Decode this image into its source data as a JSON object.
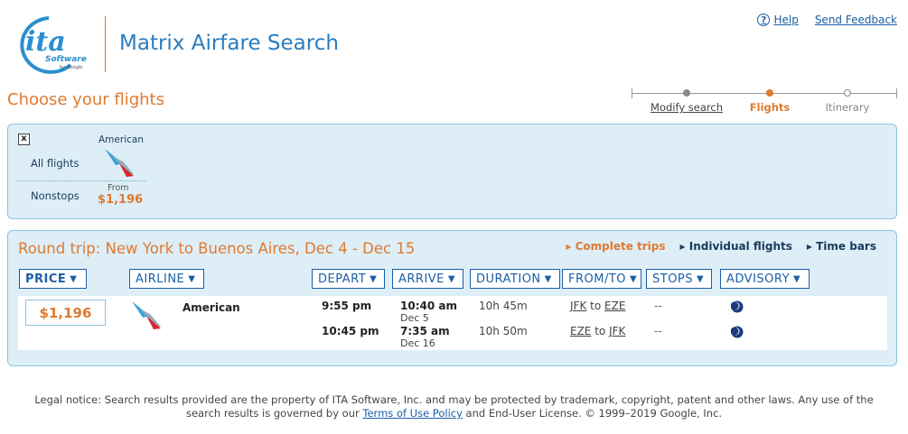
{
  "header": {
    "logo_text": "ita",
    "logo_sub": "Software",
    "logo_byline": "by Google",
    "app_title": "Matrix Airfare Search",
    "help_label": "Help",
    "feedback_label": "Send Feedback"
  },
  "page_heading": "Choose your flights",
  "steps": [
    {
      "label": "Modify search"
    },
    {
      "label": "Flights"
    },
    {
      "label": "Itinerary"
    }
  ],
  "matrix": {
    "close_label": "x",
    "all_label": "All flights",
    "nonstop_label": "Nonstops",
    "airline": "American",
    "from_label": "From",
    "from_price": "$1,196"
  },
  "results": {
    "title": "Round trip: New York to Buenos Aires, Dec 4 - Dec 15",
    "view_links": {
      "complete": "▸ Complete trips",
      "individual": "▸ Individual flights",
      "timebars": "▸ Time bars"
    },
    "columns": {
      "price": "PRICE",
      "airline": "AIRLINE",
      "depart": "DEPART",
      "arrive": "ARRIVE",
      "duration": "DURATION",
      "fromto": "FROM/TO",
      "stops": "STOPS",
      "advisory": "ADVISORY"
    },
    "sort_arrow": "▼",
    "row": {
      "price": "$1,196",
      "airline": "American",
      "legs": [
        {
          "depart": "9:55 pm",
          "arrive": "10:40 am",
          "arrive_date": "Dec 5",
          "duration": "10h 45m",
          "from": "JFK",
          "to_word": "to",
          "to": "EZE",
          "stops": "--",
          "advisory": "overnight-moon-icon"
        },
        {
          "depart": "10:45 pm",
          "arrive": "7:35 am",
          "arrive_date": "Dec 16",
          "duration": "10h 50m",
          "from": "EZE",
          "to_word": "to",
          "to": "JFK",
          "stops": "--",
          "advisory": "overnight-moon-icon"
        }
      ]
    }
  },
  "legal": {
    "text_1": "Legal notice: Search results provided are the property of ITA Software, Inc. and may be protected by trademark, copyright, patent and other laws. Any use of the search results is governed by our",
    "link": "Terms of Use Policy",
    "text_2": "and End-User License. © 1999–2019 Google, Inc."
  },
  "colors": {
    "accent_orange": "#e07a2e",
    "link_blue": "#1a5fa6",
    "panel_bg": "#ddeef7",
    "title_blue": "#2a7cbf"
  }
}
